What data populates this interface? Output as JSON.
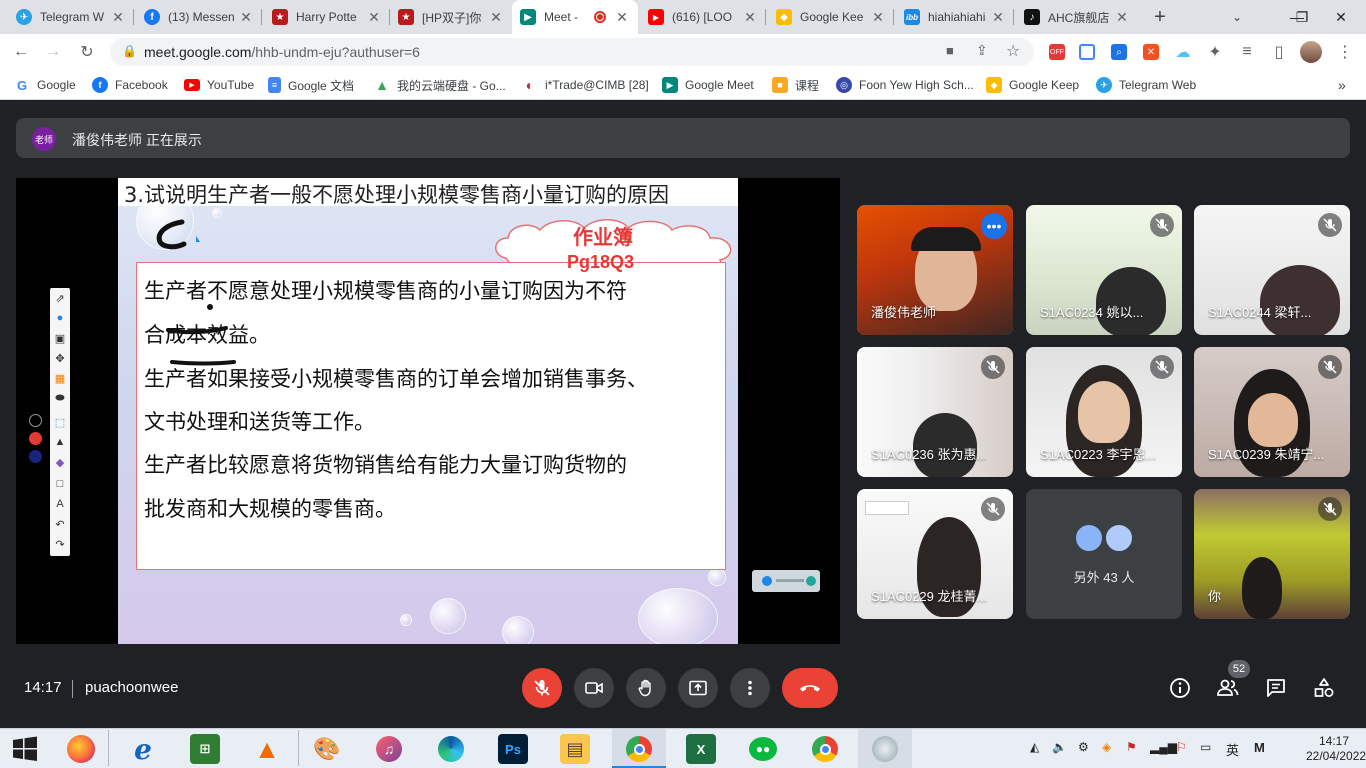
{
  "browser": {
    "tabs": [
      {
        "title": "Telegram W",
        "color": "#2aa1e2",
        "glyph": "✈"
      },
      {
        "title": "(13) Messen",
        "color": "#1877f2",
        "glyph": "f"
      },
      {
        "title": "Harry Potte",
        "color": "#b71c1c",
        "glyph": "★"
      },
      {
        "title": "[HP双子]你",
        "color": "#b71c1c",
        "glyph": "★"
      },
      {
        "title": "Meet -",
        "color": "#00897b",
        "glyph": "▶"
      },
      {
        "title": "(616) [LOO",
        "color": "#ff0000",
        "glyph": "▶"
      },
      {
        "title": "Google Kee",
        "color": "#fbbc04",
        "glyph": "◆"
      },
      {
        "title": "hiahiahiahia",
        "color": "#1e88e5",
        "glyph": "ibb"
      },
      {
        "title": "AHC旗舰店",
        "color": "#111111",
        "glyph": "♪"
      }
    ],
    "new_tab": "+",
    "url": "meet.google.com/hhb-undm-eju?authuser=6",
    "url_host": "meet.google.com",
    "url_path": "/hhb-undm-eju?authuser=6",
    "bookmarks": [
      {
        "label": "Google",
        "color": "#4285f4",
        "glyph": "G"
      },
      {
        "label": "Facebook",
        "color": "#1877f2",
        "glyph": "f"
      },
      {
        "label": "YouTube",
        "color": "#ff0000",
        "glyph": "▶"
      },
      {
        "label": "Google 文档",
        "color": "#4285f4",
        "glyph": "≡"
      },
      {
        "label": "我的云端硬盘 - Go...",
        "color": "#34a853",
        "glyph": "▲"
      },
      {
        "label": "i*Trade@CIMB [28]",
        "color": "#c62828",
        "glyph": "◐"
      },
      {
        "label": "Google Meet",
        "color": "#00897b",
        "glyph": "▶"
      },
      {
        "label": "课程",
        "color": "#f9a825",
        "glyph": "■"
      },
      {
        "label": "Foon Yew High Sch...",
        "color": "#3949ab",
        "glyph": "◎"
      },
      {
        "label": "Google Keep",
        "color": "#fbbc04",
        "glyph": "◆"
      },
      {
        "label": "Telegram Web",
        "color": "#2aa1e2",
        "glyph": "✈"
      }
    ],
    "bookmarks_more": "»"
  },
  "meet": {
    "presenter_avatar": "老师",
    "presenting_text": "潘俊伟老师 正在展示",
    "slide": {
      "title": "3.试说明生产者一般不愿处理小规模零售商小量订购的原因",
      "cloud_line1": "作业簿",
      "cloud_line2": "Pg18Q3",
      "lines": [
        "生产者不愿意处理小规模零售商的小量订购因为不符",
        "合成本效益。",
        "生产者如果接受小规模零售商的订单会增加销售事务、",
        "文书处理和送货等工作。",
        "生产者比较愿意将货物销售给有能力大量订购货物的",
        "批发商和大规模的零售商。"
      ]
    },
    "tiles": [
      {
        "name": "潘俊伟老师"
      },
      {
        "name": "S1AC0234 姚以..."
      },
      {
        "name": "S1AC0244 梁轩..."
      },
      {
        "name": "S1AC0236 张为惠..."
      },
      {
        "name": "S1AC0223 李宇恩..."
      },
      {
        "name": "S1AC0239 朱靖宁..."
      },
      {
        "name": "S1AC0229 龙桂菁..."
      },
      {
        "name": "另外 43 人"
      },
      {
        "name": "你"
      }
    ],
    "time": "14:17",
    "meeting_code": "puachoonwee",
    "people_count": "52"
  },
  "taskbar": {
    "ps_label": "Ps",
    "ime": "英",
    "ime2": "M",
    "time": "14:17",
    "date": "22/04/2022"
  }
}
